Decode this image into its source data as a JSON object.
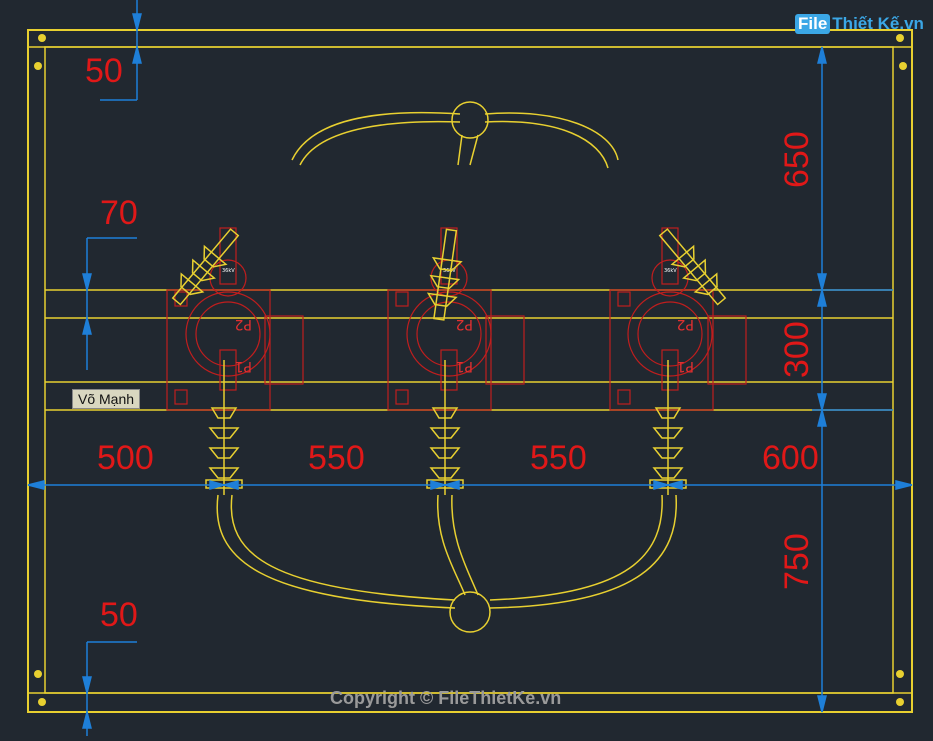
{
  "logo": {
    "badge": "File",
    "rest": "Thiết Kế",
    "tld": ".vn"
  },
  "copyright": "Copyright © FileThietKe.vn",
  "user_tag": "Võ Mạnh",
  "device_label": "36kV",
  "terminals": {
    "p1": "P1",
    "p2": "P2"
  },
  "dimensions": {
    "top_margin": "50",
    "bottom_margin": "50",
    "bar_offset": "70",
    "spacing_left": "500",
    "spacing_mid1": "550",
    "spacing_mid2": "550",
    "spacing_right": "600",
    "height_top": "650",
    "height_mid": "300",
    "height_bottom": "750"
  },
  "colors": {
    "background": "#212830",
    "frame": "#e8d030",
    "equipment": "#c01e1e",
    "dimension": "#1e7fd8",
    "text": "#e01818"
  }
}
